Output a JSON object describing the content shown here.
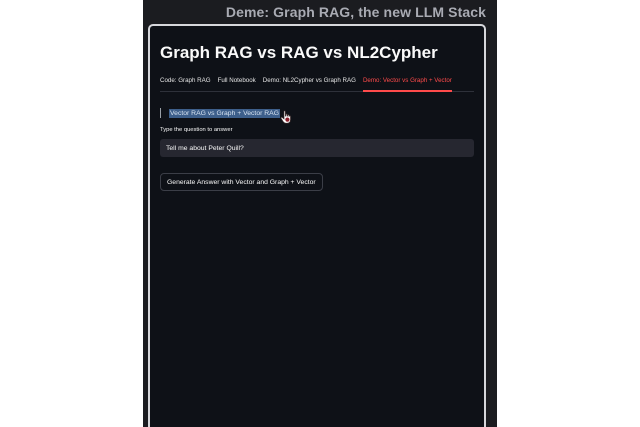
{
  "banner": {
    "title": "Deme: Graph RAG, the new LLM Stack"
  },
  "app": {
    "title": "Graph RAG vs RAG vs NL2Cypher",
    "tabs": [
      {
        "label": "Code: Graph RAG",
        "active": false
      },
      {
        "label": "Full Notebook",
        "active": false
      },
      {
        "label": "Demo: NL2Cypher vs Graph RAG",
        "active": false
      },
      {
        "label": "Demo: Vector vs Graph + Vector",
        "active": true
      }
    ],
    "section_heading": "Vector RAG vs Graph + Vector RAG",
    "question": {
      "label": "Type the question to answer",
      "value": "Tell me about Peter Quill?"
    },
    "generate_button": "Generate Answer with Vector and Graph + Vector"
  },
  "colors": {
    "accent": "#ff4b4b",
    "background": "#0e1117",
    "input_bg": "#262730",
    "selection": "#3d5f8b"
  },
  "icons": {
    "cursor": "hand-pointer-icon"
  }
}
